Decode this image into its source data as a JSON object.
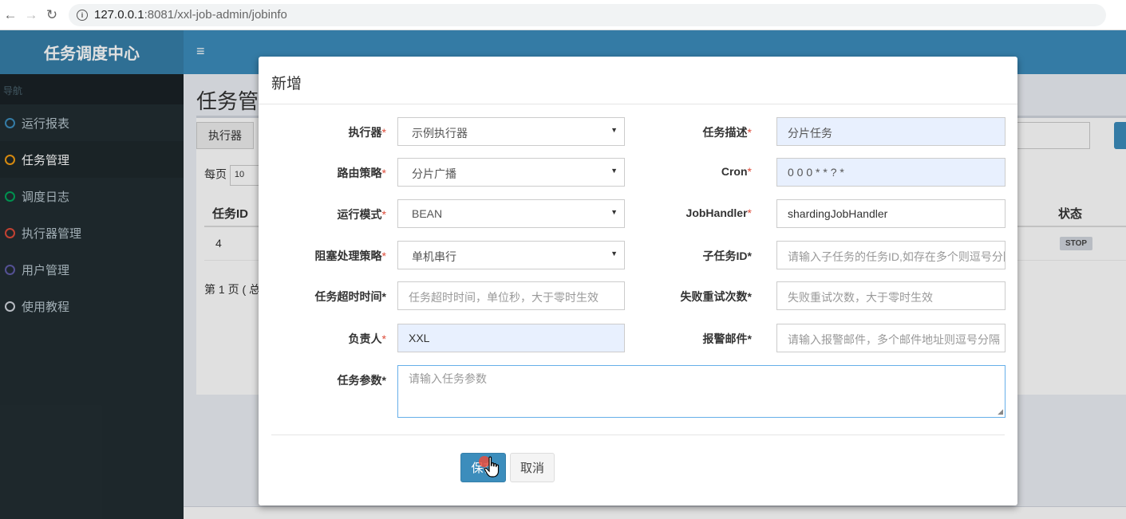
{
  "browser": {
    "url_host": "127.0.0.1",
    "url_rest": ":8081/xxl-job-admin/jobinfo"
  },
  "app": {
    "logo": "任务调度中心",
    "menu_toggle": "≡"
  },
  "sidebar": {
    "header": "导航",
    "items": [
      {
        "label": "运行报表",
        "color": "#3c8dbc"
      },
      {
        "label": "任务管理",
        "color": "#f39c12"
      },
      {
        "label": "调度日志",
        "color": "#00a65a"
      },
      {
        "label": "执行器管理",
        "color": "#dd4b39"
      },
      {
        "label": "用户管理",
        "color": "#605ca8"
      },
      {
        "label": "使用教程",
        "color": "#d2d6de"
      }
    ]
  },
  "content": {
    "title": "任务管",
    "executor_label": "执行器",
    "per_page_label": "每页",
    "per_page_value": "10",
    "col_id": "任务ID",
    "col_status": "状态",
    "row_id": "4",
    "row_status": "STOP",
    "page_info": "第 1 页 ( 总"
  },
  "modal": {
    "title": "新增",
    "fields": {
      "executor": {
        "label": "执行器",
        "value": "示例执行器"
      },
      "desc": {
        "label": "任务描述",
        "value": "分片任务"
      },
      "route": {
        "label": "路由策略",
        "value": "分片广播"
      },
      "cron": {
        "label": "Cron",
        "value": "0 0 0 * * ? *"
      },
      "glue": {
        "label": "运行模式",
        "value": "BEAN"
      },
      "handler": {
        "label": "JobHandler",
        "value": "shardingJobHandler"
      },
      "block": {
        "label": "阻塞处理策略",
        "value": "单机串行"
      },
      "child": {
        "label": "子任务ID",
        "placeholder": "请输入子任务的任务ID,如存在多个则逗号分隔"
      },
      "timeout": {
        "label": "任务超时时间",
        "placeholder": "任务超时时间，单位秒，大于零时生效"
      },
      "retry": {
        "label": "失败重试次数",
        "placeholder": "失败重试次数，大于零时生效"
      },
      "author": {
        "label": "负责人",
        "value": "XXL"
      },
      "email": {
        "label": "报警邮件",
        "placeholder": "请输入报警邮件，多个邮件地址则逗号分隔"
      },
      "param": {
        "label": "任务参数",
        "placeholder": "请输入任务参数"
      }
    },
    "save": "保存",
    "cancel": "取消"
  }
}
